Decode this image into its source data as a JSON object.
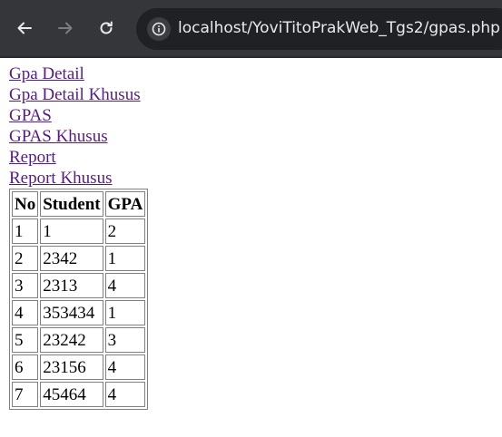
{
  "browser": {
    "back_icon": "arrow-left-icon",
    "forward_icon": "arrow-right-icon",
    "reload_icon": "reload-icon",
    "site_info_icon": "site-info-icon",
    "url": "localhost/YoviTitoPrakWeb_Tgs2/gpas.php",
    "colors": {
      "toolbar_bg": "#35363a",
      "omnibox_bg": "#202124",
      "icon": "#e8eaed",
      "icon_disabled": "#7c7d80",
      "visited_link": "#551a8b"
    }
  },
  "nav_links": [
    "Gpa Detail",
    "Gpa Detail Khusus",
    "GPAS",
    "GPAS Khusus",
    "Report",
    "Report Khusus"
  ],
  "table": {
    "headers": [
      "No",
      "Student",
      "GPA"
    ],
    "rows": [
      [
        "1",
        "1",
        "2"
      ],
      [
        "2",
        "2342",
        "1"
      ],
      [
        "3",
        "2313",
        "4"
      ],
      [
        "4",
        "353434",
        "1"
      ],
      [
        "5",
        "23242",
        "3"
      ],
      [
        "6",
        "23156",
        "4"
      ],
      [
        "7",
        "45464",
        "4"
      ]
    ]
  }
}
